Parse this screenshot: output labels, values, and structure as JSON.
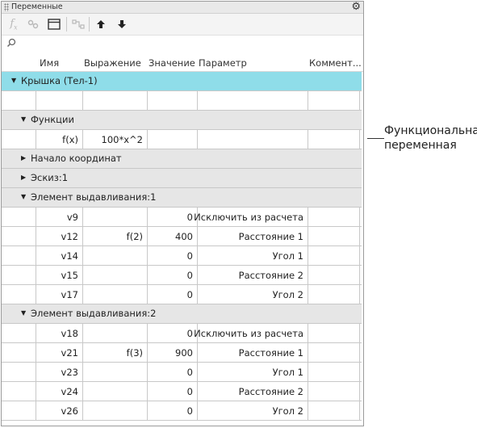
{
  "panel": {
    "title": "Переменные"
  },
  "toolbar": {
    "buttons": [
      {
        "icon": "fx-icon",
        "label": "fx",
        "enabled": false
      },
      {
        "icon": "link-icon",
        "enabled": false
      },
      {
        "icon": "window-icon",
        "enabled": true
      },
      {
        "icon": "tree-icon",
        "enabled": false
      },
      {
        "icon": "arrow-up-icon",
        "enabled": true
      },
      {
        "icon": "arrow-down-icon",
        "enabled": true
      }
    ]
  },
  "search": {
    "icon": "search-icon",
    "value": ""
  },
  "columns": {
    "name": "Имя",
    "expression": "Выражение",
    "value": "Значение",
    "parameter": "Параметр",
    "comment": "Коммент..."
  },
  "root": {
    "label": "Крышка (Тел-1)",
    "color": "#8fdde9"
  },
  "groups": [
    {
      "label": "Функции",
      "expanded": true,
      "rows": [
        {
          "name": "f(x)",
          "expression": "100*x^2",
          "value": "",
          "parameter": ""
        }
      ]
    },
    {
      "label": "Начало координат",
      "expanded": false,
      "rows": []
    },
    {
      "label": "Эскиз:1",
      "expanded": false,
      "rows": []
    },
    {
      "label": "Элемент выдавливания:1",
      "expanded": true,
      "rows": [
        {
          "name": "v9",
          "expression": "",
          "value": "0",
          "parameter": "Исключить из расчета"
        },
        {
          "name": "v12",
          "expression": "f(2)",
          "value": "400",
          "parameter": "Расстояние 1"
        },
        {
          "name": "v14",
          "expression": "",
          "value": "0",
          "parameter": "Угол 1"
        },
        {
          "name": "v15",
          "expression": "",
          "value": "0",
          "parameter": "Расстояние 2"
        },
        {
          "name": "v17",
          "expression": "",
          "value": "0",
          "parameter": "Угол 2"
        }
      ]
    },
    {
      "label": "Элемент выдавливания:2",
      "expanded": true,
      "rows": [
        {
          "name": "v18",
          "expression": "",
          "value": "0",
          "parameter": "Исключить из расчета"
        },
        {
          "name": "v21",
          "expression": "f(3)",
          "value": "900",
          "parameter": "Расстояние 1"
        },
        {
          "name": "v23",
          "expression": "",
          "value": "0",
          "parameter": "Угол 1"
        },
        {
          "name": "v24",
          "expression": "",
          "value": "0",
          "parameter": "Расстояние 2"
        },
        {
          "name": "v26",
          "expression": "",
          "value": "0",
          "parameter": "Угол 2"
        }
      ]
    }
  ],
  "callout": {
    "line1": "Функциональная",
    "line2": "переменная"
  }
}
